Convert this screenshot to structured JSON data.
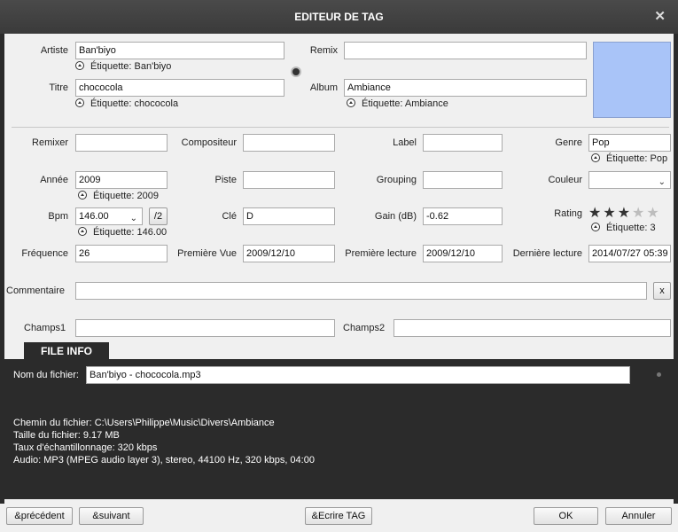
{
  "window": {
    "title": "EDITEUR DE TAG",
    "close_glyph": "✕"
  },
  "top": {
    "artist": {
      "label": "Artiste",
      "value": "Ban'biyo",
      "hint": "Étiquette: Ban'biyo"
    },
    "title": {
      "label": "Titre",
      "value": "chococola",
      "hint": "Étiquette: chococola"
    },
    "remix": {
      "label": "Remix",
      "value": ""
    },
    "album": {
      "label": "Album",
      "value": "Ambiance",
      "hint": "Étiquette: Ambiance"
    },
    "artwork_color": "#a9c4f8"
  },
  "fields": {
    "remixer": {
      "label": "Remixer",
      "value": ""
    },
    "composer": {
      "label": "Compositeur",
      "value": ""
    },
    "labelf": {
      "label": "Label",
      "value": ""
    },
    "genre": {
      "label": "Genre",
      "value": "Pop",
      "hint": "Étiquette: Pop"
    },
    "year": {
      "label": "Année",
      "value": "2009",
      "hint": "Étiquette: 2009"
    },
    "track": {
      "label": "Piste",
      "value": ""
    },
    "grouping": {
      "label": "Grouping",
      "value": ""
    },
    "color": {
      "label": "Couleur",
      "value": ""
    },
    "bpm": {
      "label": "Bpm",
      "value": "146.00",
      "hint": "Étiquette: 146.00",
      "half_button": "/2"
    },
    "key": {
      "label": "Clé",
      "value": "D"
    },
    "gain": {
      "label": "Gain (dB)",
      "value": "-0.62"
    },
    "rating": {
      "label": "Rating",
      "stars": 3,
      "max": 5,
      "hint": "Étiquette: 3"
    },
    "frequency": {
      "label": "Fréquence",
      "value": "26"
    },
    "first_seen": {
      "label": "Première Vue",
      "value": "2009/12/10"
    },
    "first_play": {
      "label": "Première lecture",
      "value": "2009/12/10"
    },
    "last_play": {
      "label": "Dernière lecture",
      "value": "2014/07/27 05:39"
    },
    "comment": {
      "label": "Commentaire",
      "value": "",
      "clear_button": "x"
    },
    "field1": {
      "label": "Champs1",
      "value": ""
    },
    "field2": {
      "label": "Champs2",
      "value": ""
    }
  },
  "file_info": {
    "tab_label": "FILE INFO",
    "filename_label": "Nom du fichier:",
    "filename": "Ban'biyo - chococola.mp3",
    "lines": [
      "Chemin du fichier: C:\\Users\\Philippe\\Music\\Divers\\Ambiance",
      "Taille du fichier: 9.17 MB",
      "Taux d'échantillonnage: 320 kbps",
      "Audio: MP3 (MPEG audio layer 3), stereo, 44100 Hz, 320 kbps, 04:00"
    ]
  },
  "buttons": {
    "prev": "&précédent",
    "next": "&suivant",
    "write": "&Ecrire TAG",
    "ok": "OK",
    "cancel": "Annuler"
  }
}
